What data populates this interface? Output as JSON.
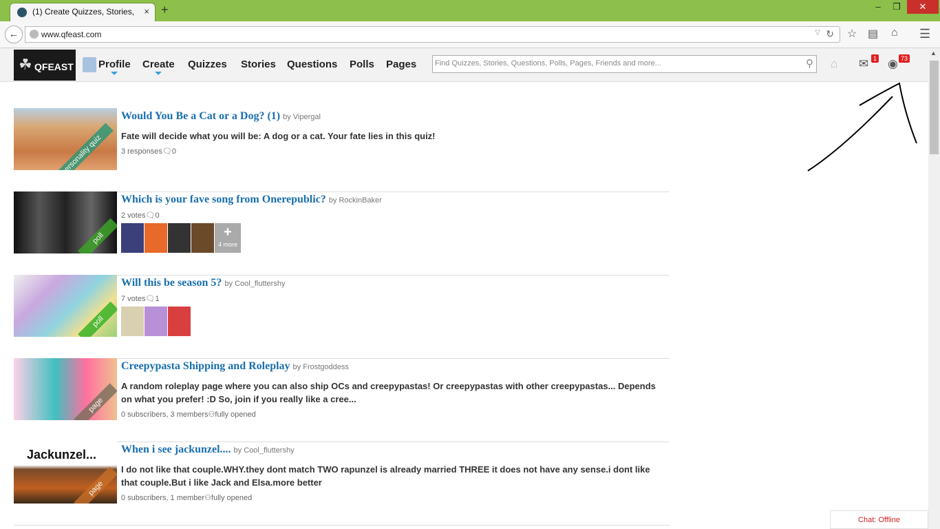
{
  "browser": {
    "tab_title": "(1) Create Quizzes, Stories, Qu...",
    "tab_close": "×",
    "new_tab": "+",
    "url": "www.qfeast.com",
    "window_controls": [
      "–",
      "❐",
      "✕"
    ]
  },
  "site": {
    "logo_text": "QFEAST",
    "nav": [
      "Profile",
      "Create",
      "Quizzes",
      "Stories",
      "Questions",
      "Polls",
      "Pages"
    ],
    "search_placeholder": "Find Quizzes, Stories, Questions, Polls, Pages, Friends and more...",
    "messages_badge": "1",
    "notifications_badge": "73"
  },
  "feed": [
    {
      "title": "Would You Be a Cat or a Dog? (1)",
      "by": "by Vipergal",
      "description": "Fate will decide what you will be: A dog or a cat. Your fate lies in this quiz!",
      "meta": "3 responses",
      "comments": "0",
      "tag": "personality quiz"
    },
    {
      "title": "Which is your fave song from Onerepublic?",
      "by": "by RockinBaker",
      "meta": "2 votes",
      "comments": "0",
      "tag": "poll",
      "more_label": "4 more"
    },
    {
      "title": "Will this be season 5?",
      "by": "by Cool_fluttershy",
      "meta": "7 votes",
      "comments": "1",
      "tag": "poll"
    },
    {
      "title": "Creepypasta Shipping and Roleplay",
      "by": "by Frostgoddess",
      "description": "A random roleplay page where you can also ship OCs and creepypastas! Or creepypastas with other creepypastas... Depends on what you prefer! :D So, join if you really like a cree...",
      "meta": "0 subscribers, 3 members",
      "status": "fully opened",
      "tag": "page"
    },
    {
      "title": "When i see jackunzel....",
      "by": "by Cool_fluttershy",
      "description": "I do not like that couple.WHY.they dont match TWO rapunzel is already married THREE it does not have any sense.i dont like that couple.But i like Jack and Elsa.more better",
      "meta": "0 subscribers, 1 member",
      "status": "fully opened",
      "tag": "page",
      "thumb_caption": "Jackunzel..."
    }
  ],
  "chat": "Chat: Offline",
  "colors": {
    "titlebar": "#8cc04a",
    "link": "#1a6fae",
    "badge": "#e02020"
  }
}
